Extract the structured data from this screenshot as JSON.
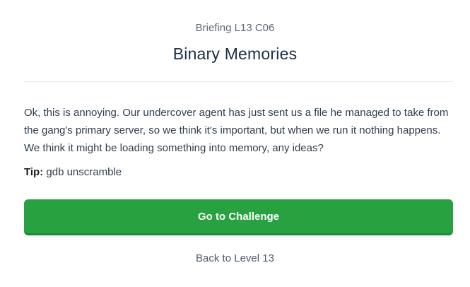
{
  "header": {
    "subtitle": "Briefing L13 C06",
    "title": "Binary Memories"
  },
  "briefing": {
    "text": "Ok, this is annoying. Our undercover agent has just sent us a file he managed to take from the gang's primary server, so we think it's important, but when we run it nothing happens. We think it might be loading something into memory, any ideas?",
    "tip_label": "Tip:",
    "tip_text": " gdb unscramble"
  },
  "actions": {
    "primary_label": "Go to Challenge",
    "back_label": "Back to Level 13"
  },
  "colors": {
    "primary_button": "#28a141",
    "title_text": "#1e2f44",
    "subtitle_text": "#5a6b7d"
  }
}
